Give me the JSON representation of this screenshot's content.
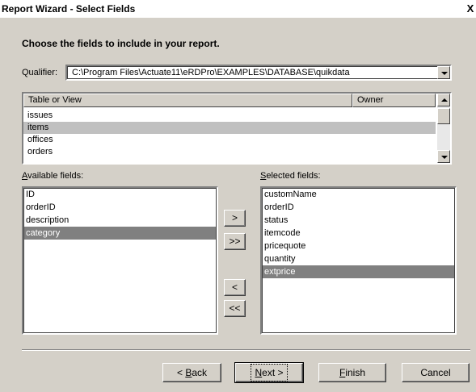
{
  "window": {
    "title": "Report Wizard - Select Fields",
    "close_glyph": "X"
  },
  "heading": "Choose the fields to include in your report.",
  "qualifier": {
    "label": "Qualifier:",
    "value": "C:\\Program Files\\Actuate11\\eRDPro\\EXAMPLES\\DATABASE\\quikdata"
  },
  "table": {
    "headers": [
      "Table or View",
      "Owner"
    ],
    "rows": [
      "issues",
      "items",
      "offices",
      "orders"
    ],
    "selected": "items"
  },
  "available": {
    "label": "Available fields:",
    "items": [
      "ID",
      "orderID",
      "description",
      "category"
    ],
    "selected": "category"
  },
  "selected_fields": {
    "label": "Selected fields:",
    "items": [
      "customName",
      "orderID",
      "status",
      "itemcode",
      "pricequote",
      "quantity",
      "extprice"
    ],
    "selected": "extprice"
  },
  "move_buttons": {
    "add_one": ">",
    "add_all": ">>",
    "remove_one": "<",
    "remove_all": "<<"
  },
  "footer": {
    "back": "< Back",
    "next": "Next >",
    "finish": "Finish",
    "cancel": "Cancel"
  },
  "colors": {
    "face": "#d4d0c8",
    "selection_light": "#c0c0c0",
    "selection_dark": "#808080"
  }
}
